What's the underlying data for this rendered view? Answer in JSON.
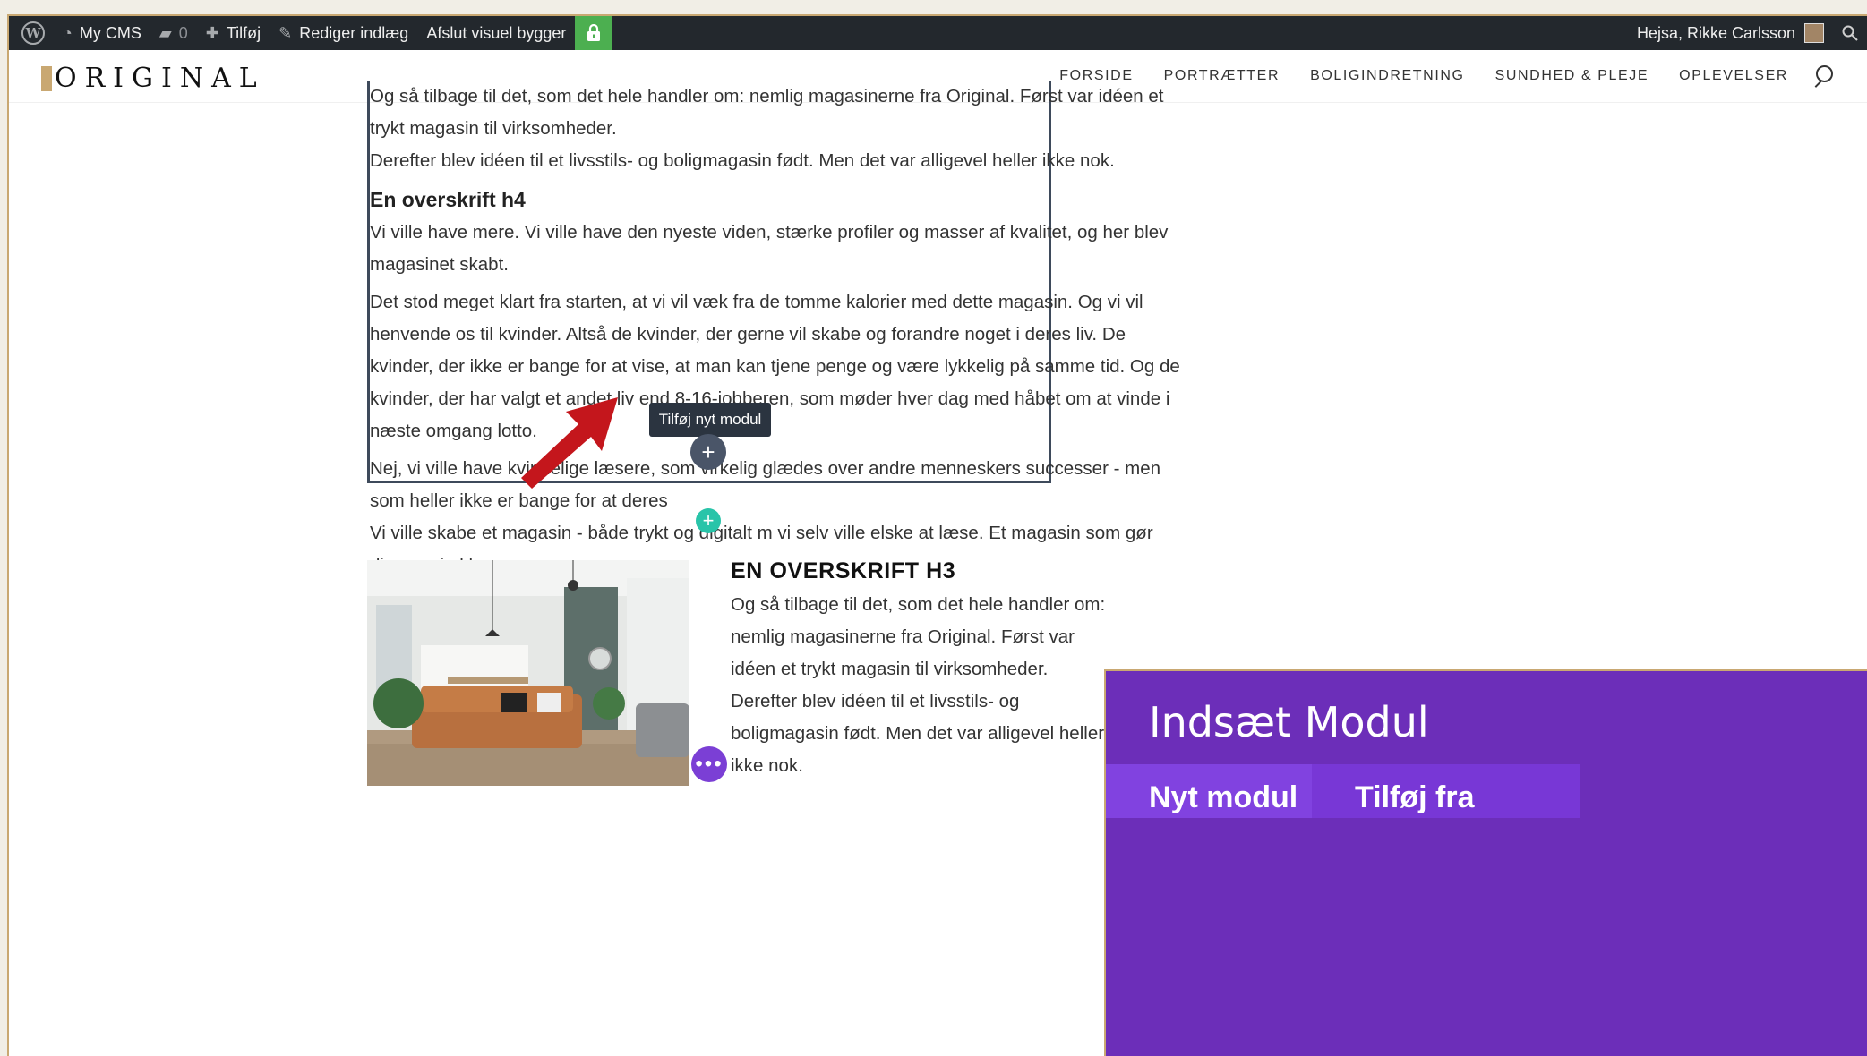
{
  "admin_bar": {
    "site_name": "My CMS",
    "comments_count": "0",
    "new_label": "Tilføj",
    "edit_label": "Rediger indlæg",
    "exit_builder_label": "Afslut visuel bygger",
    "greeting": "Hejsa, Rikke Carlsson"
  },
  "site": {
    "logo_text": "ORIGINAL",
    "nav": [
      "FORSIDE",
      "PORTRÆTTER",
      "BOLIGINDRETNING",
      "SUNDHED & PLEJE",
      "OPLEVELSER"
    ]
  },
  "text_module": {
    "para1_line1": "Og så tilbage til det, som det hele handler om: nemlig magasinerne fra Original. Først var idéen et",
    "para1_line2": "trykt magasin til virksomheder.",
    "para1_line3": "Derefter blev idéen til et livsstils- og boligmagasin født. Men det var alligevel heller ikke nok.",
    "heading_h4": "En overskrift h4",
    "para2_line1": "Vi ville have mere. Vi ville have den nyeste viden, stærke profiler og masser af kvalitet, og her blev",
    "para2_line2": "magasinet skabt.",
    "para3_line1": "Det stod meget klart fra starten, at vi vil væk fra de tomme kalorier med dette magasin. Og vi vil",
    "para3_line2": "henvende os til kvinder. Altså de kvinder, der gerne vil skabe og forandre noget i deres liv. De",
    "para3_line3": "kvinder, der ikke er bange for at vise, at man kan tjene penge og være lykkelig på samme tid. Og de",
    "para3_line4": "kvinder, der har valgt et andet liv end 8-16-jobberen, som møder hver dag med håbet om at vinde i",
    "para3_line5": "næste omgang lotto.",
    "para4_line1": "Nej, vi ville have kvindelige læsere, som virkelig glædes over andre menneskers successer - men",
    "para4_line2": "som heller ikke er bange for at      deres",
    "para4_line3": "Vi ville skabe et magasin - både trykt og digitalt      m vi selv ville elske at læse. Et magasin som gør",
    "para4_line4": "dig og mig klogere."
  },
  "tooltip": "Tilføj nyt modul",
  "section2": {
    "heading_h3": "EN OVERSKRIFT H3",
    "lines": [
      "Og så tilbage til det, som det hele handler om:",
      "nemlig magasinerne fra Original. Først var",
      "idéen et trykt magasin til virksomheder.",
      "Derefter blev idéen til et livsstils- og",
      "boligmagasin født. Men det var alligevel heller",
      "ikke nok."
    ]
  },
  "insert_panel": {
    "title": "Indsæt Modul",
    "tab1": "Nyt modul",
    "tab2": "Tilføj fra bibliotek"
  },
  "colors": {
    "admin_bar_bg": "#23282d",
    "lock_green": "#4caf50",
    "module_border": "#3e4a5b",
    "add_row_teal": "#29c4a9",
    "builder_purple": "#6c2eb9",
    "brand_gold": "#c9a872",
    "arrow_red": "#c4161c"
  }
}
